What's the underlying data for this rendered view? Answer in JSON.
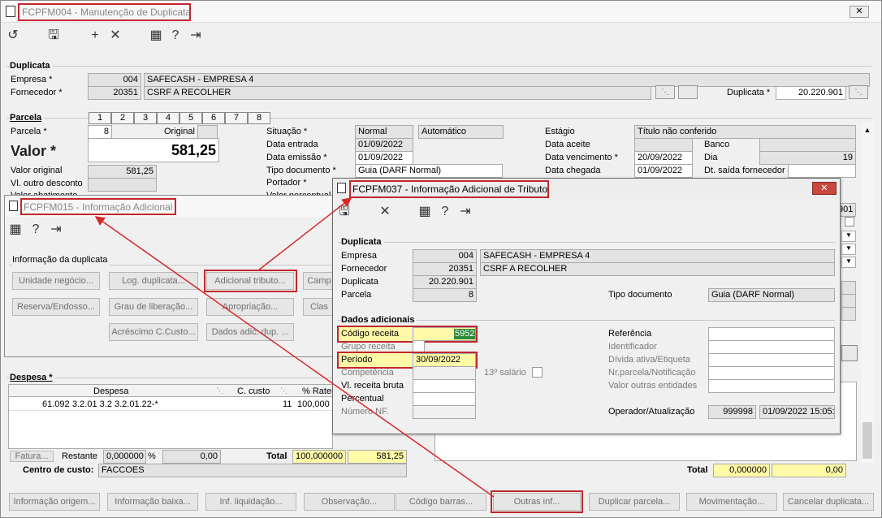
{
  "main": {
    "title": "FCPFM004 - Manutenção de Duplicata",
    "duplicata": {
      "section": "Duplicata",
      "empresa_label": "Empresa *",
      "empresa_code": "004",
      "empresa_name": "SAFECASH -  EMPRESA 4",
      "fornecedor_label": "Fornecedor *",
      "fornecedor_code": "20351",
      "fornecedor_name": "CSRF A RECOLHER",
      "duplicata_label": "Duplicata *",
      "duplicata_value": "20.220.901"
    },
    "parcela": {
      "section": "Parcela",
      "tabs": [
        "1",
        "2",
        "3",
        "4",
        "5",
        "6",
        "7",
        "8"
      ],
      "parcela_label": "Parcela *",
      "parcela_value": "8",
      "original_label": "Original",
      "valor_label": "Valor *",
      "valor_value": "581,25",
      "valor_original_label": "Valor original",
      "valor_original_value": "581,25",
      "outro_desc_label": "Vl. outro desconto",
      "abatimento_label": "Valor abatimento",
      "situacao_label": "Situação *",
      "situacao_value": "Normal",
      "situacao_tipo": "Automático",
      "entrada_label": "Data entrada",
      "entrada_value": "01/09/2022",
      "emissao_label": "Data emissão *",
      "emissao_value": "01/09/2022",
      "tipo_doc_label": "Tipo documento *",
      "tipo_doc_value": "Guia (DARF Normal)",
      "portador_label": "Portador *",
      "valor_percentual_label": "Valor percentual",
      "estagio_label": "Estágio",
      "estagio_value": "Título não conferido",
      "aceite_label": "Data aceite",
      "banco_label": "Banco",
      "vencimento_label": "Data vencimento *",
      "vencimento_value": "20/09/2022",
      "dia_label": "Dia",
      "dia_value": "19",
      "chegada_label": "Data chegada",
      "chegada_value": "01/09/2022",
      "saida_label": "Dt. saída fornecedor",
      "side_value": "901"
    },
    "despesa": {
      "section": "Despesa *",
      "col_despesa": "Despesa",
      "col_ccusto": "C. custo",
      "col_rateio": "% Rater",
      "row_code": "61.092",
      "row_desc": "3.2.01 3.2 3.2.01.22-*",
      "row_cc": "11",
      "row_pct": "100,000",
      "fatura_label": "Fatura...",
      "restante_label": "Restante",
      "restante_pct": "0,000000",
      "pct_sign": "%",
      "restante_val": "0,00",
      "total_label": "Total",
      "total_pct": "100,000000",
      "total_val": "581,25",
      "centro_label": "Centro de custo:",
      "centro_value": "FACCOES"
    },
    "right_total": {
      "label": "Total",
      "pct": "0,000000",
      "val": "0,00"
    },
    "bottom_buttons": [
      "Informação origem...",
      "Informação baixa...",
      "Inf. liquidação...",
      "Observação...",
      "Código barras...",
      "Outras inf...",
      "Duplicar parcela...",
      "Movimentação...",
      "Cancelar duplicata..."
    ]
  },
  "info_window": {
    "title": "FCPFM015 - Informação Adicional",
    "section": "Informação da duplicata",
    "buttons": [
      "Unidade negócio...",
      "Log. duplicata...",
      "Adicional tributo...",
      "Camp",
      "Reserva/Endosso...",
      "Grau de liberação...",
      "Apropriação...",
      "Clas",
      "Acréscimo C.Custo...",
      "Dados adic. dup. ..."
    ]
  },
  "tributo_window": {
    "title": "FCPFM037 - Informação Adicional de Tributo",
    "dup_section": "Duplicata",
    "empresa_label": "Empresa",
    "empresa_code": "004",
    "empresa_name": "SAFECASH -  EMPRESA 4",
    "fornecedor_label": "Fornecedor",
    "fornecedor_code": "20351",
    "fornecedor_name": "CSRF A RECOLHER",
    "duplicata_label": "Duplicata",
    "duplicata_value": "20.220.901",
    "parcela_label": "Parcela",
    "parcela_value": "8",
    "tipo_doc_label": "Tipo documento",
    "tipo_doc_value": "Guia (DARF Normal)",
    "dados_section": "Dados adicionais",
    "codigo_receita_label": "Código receita",
    "codigo_receita_value": "5952",
    "grupo_receita_label": "Grupo receita",
    "periodo_label": "Período",
    "periodo_value": "30/09/2022",
    "competencia_label": "Competência",
    "salario_label": "13º salário",
    "receita_bruta_label": "Vl. receita bruta",
    "percentual_label": "Percentual",
    "numero_nf_label": "Número NF.",
    "referencia_label": "Referência",
    "identificador_label": "Identificador",
    "divida_label": "Dívida ativa/Etiqueta",
    "nr_parcela_label": "Nr.parcela/Notificação",
    "valor_outras_label": "Valor outras entidades",
    "operador_label": "Operador/Atualização",
    "operador_value": "999998",
    "atualizacao_value": "01/09/2022 15:05:"
  },
  "colors": {
    "highlight_border": "#c1272d",
    "field_highlight": "#fff9a8",
    "selected_text_bg": "#2e8b3c"
  }
}
